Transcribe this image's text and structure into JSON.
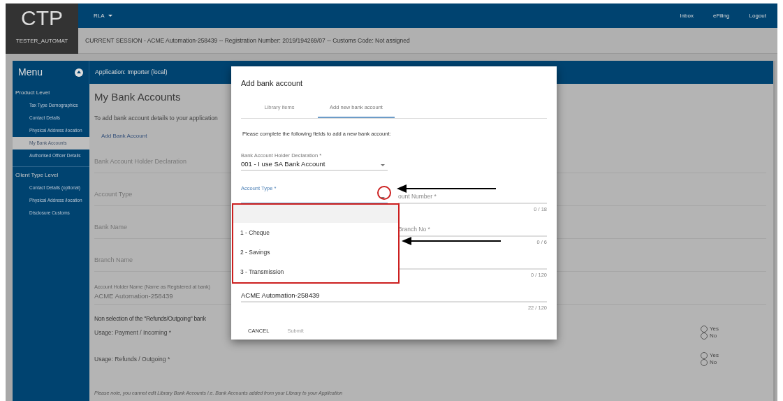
{
  "header": {
    "logo": "CTP",
    "user": "TESTER_AUTOMAT",
    "menu_label": "RLA",
    "links": [
      "Inbox",
      "eFiling",
      "Logout"
    ],
    "session": "CURRENT SESSION - ACME Automation-258439 -- Registration Number: 2019/194269/07 -- Customs Code: Not assigned"
  },
  "panel": {
    "menu_title": "Menu",
    "application": "Application: Importer (local)"
  },
  "sidebar": {
    "sections": [
      {
        "label": "Product Level",
        "items": [
          {
            "label": "Tax Type Demographics",
            "selected": false
          },
          {
            "label": "Contact Details",
            "selected": false
          },
          {
            "label": "Physical Address /location",
            "selected": false
          },
          {
            "label": "My Bank Accounts",
            "selected": true
          },
          {
            "label": "Authorised Officer Details",
            "selected": false
          }
        ]
      },
      {
        "label": "Client Type Level",
        "items": [
          {
            "label": "Contact Details (optional)",
            "selected": false
          },
          {
            "label": "Physical Address /location",
            "selected": false
          },
          {
            "label": "Disclosure Customs",
            "selected": false
          }
        ]
      }
    ]
  },
  "page": {
    "title": "My Bank Accounts",
    "intro": "To add bank account details to your application",
    "add_link": "Add Bank Account",
    "fields": [
      "Bank Account Holder Declaration",
      "Account Type",
      "Bank Name",
      "Branch Name"
    ],
    "holder": {
      "label": "Account Holder Name (Name as Registered at bank)",
      "value": "ACME Automation-258439"
    },
    "notice": "Non selection of the \"Refunds/Outgoing\" bank",
    "usages": [
      {
        "label": "Usage: Payment / Incoming *",
        "options": [
          {
            "label": "Yes",
            "selected": false
          },
          {
            "label": "No",
            "selected": false
          }
        ]
      },
      {
        "label": "Usage: Refunds / Outgoing *",
        "options": [
          {
            "label": "Yes",
            "selected": false
          },
          {
            "label": "No",
            "selected": false
          }
        ]
      }
    ],
    "footnote": "Please note, you cannot edit Library Bank Accounts i.e. Bank Accounts added from your Library to your Application"
  },
  "dialog": {
    "title": "Add bank account",
    "tabs": [
      {
        "label": "Library items",
        "selected": false
      },
      {
        "label": "Add new bank account",
        "selected": true
      }
    ],
    "instruction": "Please complete the following fields to add a new bank account:",
    "rows": [
      {
        "left": {
          "kind": "select",
          "label": "Bank Account Holder Declaration *",
          "value": "001 - I use SA Bank Account",
          "focused": false
        }
      },
      {
        "left": {
          "kind": "select",
          "label": "Account Type *",
          "focused": true
        },
        "right": {
          "kind": "text",
          "label": "ount Number *",
          "counter": "0 / 18",
          "focused": false
        }
      },
      {
        "right": {
          "kind": "text",
          "label": "Branch No *",
          "counter": "0 / 6",
          "focused": false
        }
      },
      {
        "right": {
          "kind": "text",
          "counter": "0 / 120",
          "focused": false
        }
      },
      {
        "full": {
          "kind": "text",
          "value": "ACME Automation-258439",
          "counter": "22 / 120",
          "focused": false
        }
      }
    ],
    "dropdown": {
      "options": [
        "1 - Cheque",
        "2 - Savings",
        "3 - Transmission"
      ]
    },
    "buttons": [
      {
        "label": "CANCEL",
        "disabled": false
      },
      {
        "label": "Submit",
        "disabled": true
      }
    ]
  }
}
